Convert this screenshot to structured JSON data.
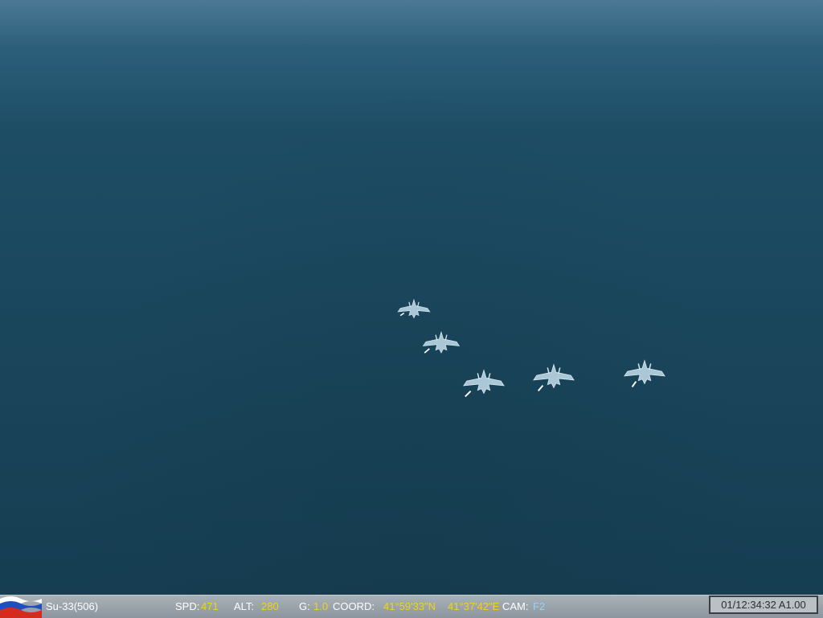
{
  "aircraft": {
    "name": "Su-33(506)",
    "flag_icon": "russia-flag-icon",
    "flag_colors": [
      "#ffffff",
      "#1f4fbf",
      "#d52b1e"
    ]
  },
  "hud": {
    "spd_label": "SPD:",
    "spd_value": "471",
    "alt_label": "ALT:",
    "alt_value": "280",
    "g_label": "G:",
    "g_value": "1.0",
    "coord_label": "COORD:",
    "coord_lat": "41°59'33\"N",
    "coord_lon": "41°37'42\"E",
    "cam_label": "CAM:",
    "cam_value": "F2"
  },
  "time": {
    "display": "01/12:34:32 A1.00"
  },
  "scene": {
    "description_icon": "jet-icon",
    "jet_count": 5,
    "sky_color": "#4b7996",
    "sea_color": "#1a465c",
    "jet_color": "#a9c7d6"
  }
}
